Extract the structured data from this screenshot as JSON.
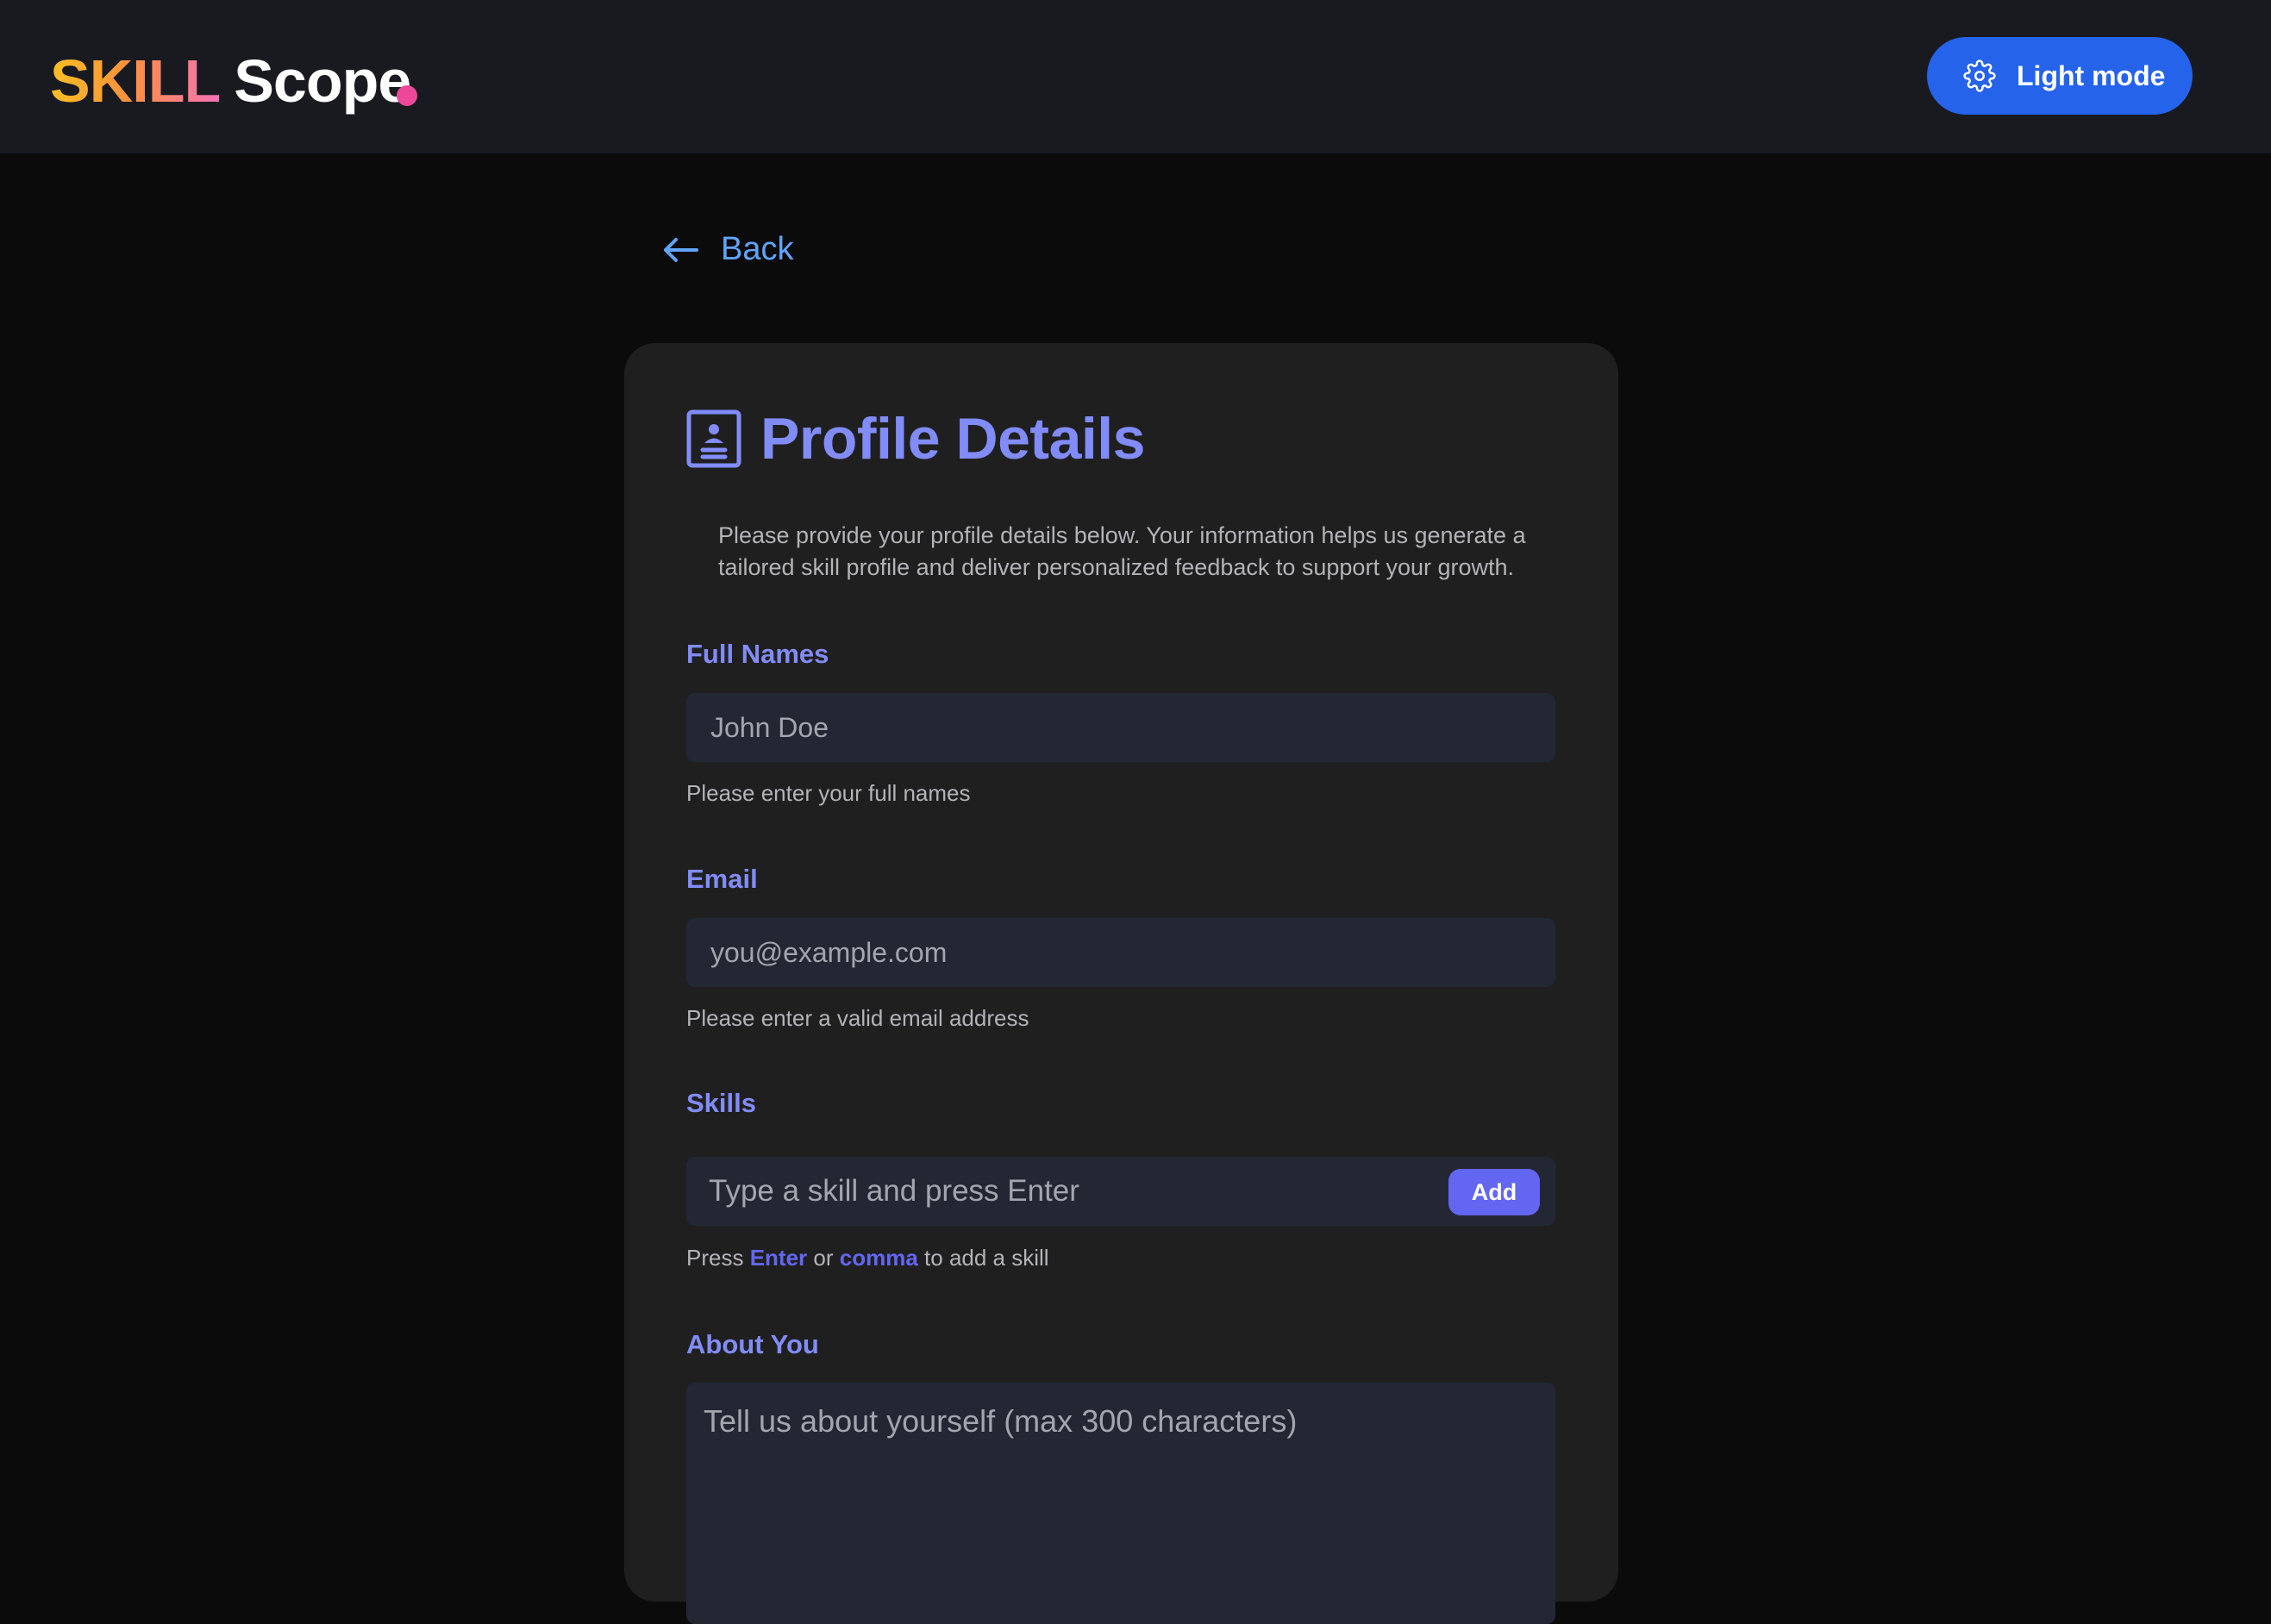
{
  "header": {
    "logo_part1": "SKILL",
    "logo_part2": "Scope",
    "theme_toggle_label": "Light mode"
  },
  "nav": {
    "back_label": "Back"
  },
  "card": {
    "title": "Profile Details",
    "intro": "Please provide your profile details below. Your information helps us generate a tailored skill profile and deliver personalized feedback to support your growth."
  },
  "form": {
    "full_names": {
      "label": "Full Names",
      "placeholder": "John Doe",
      "hint": "Please enter your full names"
    },
    "email": {
      "label": "Email",
      "placeholder": "you@example.com",
      "hint": "Please enter a valid email address"
    },
    "skills": {
      "label": "Skills",
      "placeholder": "Type a skill and press Enter",
      "add_label": "Add",
      "hint_prefix": "Press",
      "hint_key1": "Enter",
      "hint_or": "or",
      "hint_key2": "comma",
      "hint_suffix": "to add a skill"
    },
    "about": {
      "label": "About You",
      "placeholder": "Tell us about yourself (max 300 characters)"
    }
  },
  "icons": {
    "theme": "gear-icon",
    "back": "arrow-left-icon",
    "title": "id-badge-icon"
  },
  "colors": {
    "accent": "#818cf8",
    "primary_button": "#2563eb",
    "add_button": "#6366f1",
    "link": "#60a5fa",
    "logo_dot": "#ec4899"
  }
}
